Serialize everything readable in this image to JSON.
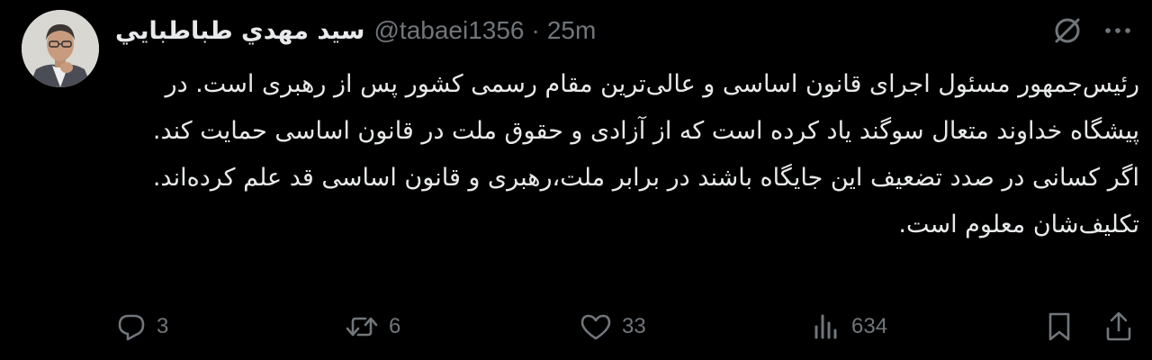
{
  "tweet": {
    "display_name": "سید مهدي طباطبايي",
    "handle": "@tabaei1356",
    "separator": "·",
    "time": "25m",
    "paragraphs": [
      "رئیس‌جمهور مسئول اجرای قانون اساسی و عالی‌ترین مقام رسمی کشور پس از رهبری است. در پیشگاه خداوند متعال سوگند یاد کرده است که از آزادی و حقوق ملت در قانون اساسی حمایت کند. اگر کسانی در صدد تضعیف این جایگاه باشند در برابر ملت،رهبری و قانون اساسی قد علم کرده‌اند.",
      "تکلیف‌شان معلوم است."
    ]
  },
  "actions": {
    "replies": "3",
    "reposts": "6",
    "likes": "33",
    "views": "634"
  },
  "icons": {
    "top_right": [
      "grok-icon",
      "more-icon"
    ],
    "actions": [
      "reply-icon",
      "repost-icon",
      "like-icon",
      "views-icon",
      "bookmark-icon",
      "share-icon"
    ]
  },
  "colors": {
    "background": "#000000",
    "text": "#e7e9ea",
    "secondary": "#71767b"
  }
}
